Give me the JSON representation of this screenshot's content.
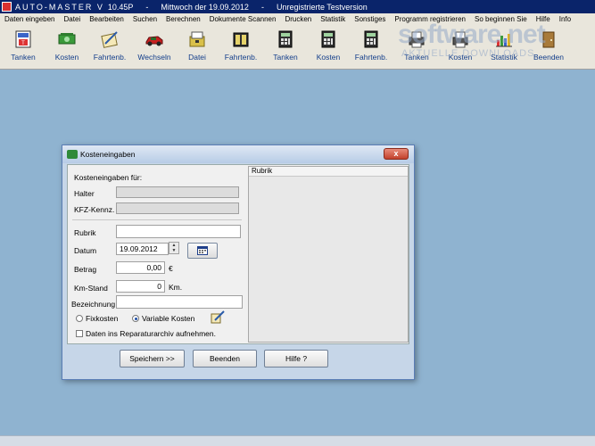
{
  "titlebar": {
    "app_title": "AUTO-MASTER V",
    "version": "10.45P",
    "separator": "-",
    "date_text": "Mittwoch der  19.09.2012",
    "separator2": "-",
    "license": "Unregistrierte Testversion"
  },
  "menu": [
    "Daten eingeben",
    "Datei",
    "Bearbeiten",
    "Suchen",
    "Berechnen",
    "Dokumente Scannen",
    "Drucken",
    "Statistik",
    "Sonstiges",
    "Programm registrieren",
    "So beginnen Sie",
    "Hilfe",
    "Info"
  ],
  "toolbar": [
    {
      "label": "Tanken",
      "icon": "fuel-form-icon"
    },
    {
      "label": "Kosten",
      "icon": "money-icon"
    },
    {
      "label": "Fahrtenb.",
      "icon": "logbook-pen-icon"
    },
    {
      "label": "Wechseln",
      "icon": "car-icon"
    },
    {
      "label": "Datei",
      "icon": "file-icon"
    },
    {
      "label": "Fahrtenb.",
      "icon": "book-icon"
    },
    {
      "label": "Tanken",
      "icon": "calculator-icon"
    },
    {
      "label": "Kosten",
      "icon": "calculator-icon"
    },
    {
      "label": "Fahrtenb.",
      "icon": "calculator-icon"
    },
    {
      "label": "Tanken",
      "icon": "printer-icon"
    },
    {
      "label": "Kosten",
      "icon": "printer-icon"
    },
    {
      "label": "Statistik",
      "icon": "chart-icon"
    },
    {
      "label": "Beenden",
      "icon": "exit-door-icon"
    }
  ],
  "watermark": {
    "main": "software.net",
    "sub": "AKTUELLE DOWNLOADS"
  },
  "dialog": {
    "title": "Kosteneingaben",
    "close": "x",
    "heading": "Kosteneingaben für:",
    "halter_label": "Halter",
    "halter_value": "",
    "kfz_label": "KFZ-Kennz.",
    "kfz_value": "",
    "rubrik_label": "Rubrik",
    "rubrik_value": "",
    "datum_label": "Datum",
    "datum_value": "19.09.2012",
    "betrag_label": "Betrag",
    "betrag_value": "0,00",
    "currency": "€",
    "km_label": "Km-Stand",
    "km_value": "0",
    "km_unit": "Km.",
    "bezeichnung_label": "Bezeichnung",
    "bezeichnung_value": "",
    "radio_fix": "Fixkosten",
    "radio_variabel": "Variable Kosten",
    "radio_selected": "variabel",
    "checkbox_label": "Daten ins Reparaturarchiv aufnehmen.",
    "checkbox_checked": false,
    "rubrik_list_header": "Rubrik",
    "btn_save": "Speichern >>",
    "btn_exit": "Beenden",
    "btn_help": "Hilfe ?"
  },
  "colors": {
    "desktop": "#8fb3d0",
    "titlebar": "#0a246a",
    "link_text": "#123d8a"
  }
}
